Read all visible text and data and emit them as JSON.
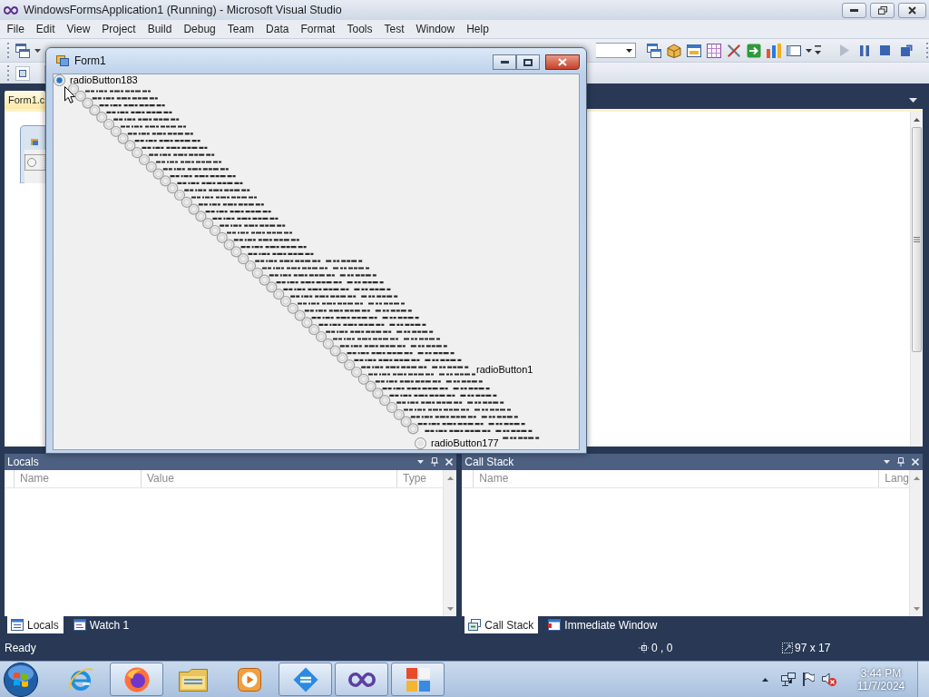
{
  "window": {
    "title": "WindowsFormsApplication1 (Running) - Microsoft Visual Studio"
  },
  "menu": [
    "File",
    "Edit",
    "View",
    "Project",
    "Build",
    "Debug",
    "Team",
    "Data",
    "Format",
    "Tools",
    "Test",
    "Window",
    "Help"
  ],
  "document_tabs": [
    {
      "label": "Form1.c",
      "selected": true
    }
  ],
  "form_window": {
    "title": "Form1",
    "radio_buttons": [
      {
        "label": "radioButton183",
        "selected": true
      },
      {
        "label": "radioButton177",
        "selected": false
      }
    ],
    "covered_radio_label": "radioButton1"
  },
  "panels": [
    {
      "title": "Locals",
      "columns": [
        "Name",
        "Value",
        "Type"
      ],
      "tabs": [
        {
          "label": "Locals",
          "selected": true
        },
        {
          "label": "Watch 1",
          "selected": false
        }
      ]
    },
    {
      "title": "Call Stack",
      "columns": [
        "Name",
        "Lang"
      ],
      "tabs": [
        {
          "label": "Call Stack",
          "selected": true
        },
        {
          "label": "Immediate Window",
          "selected": false
        }
      ]
    }
  ],
  "status_bar": {
    "text": "Ready",
    "position": "0 , 0",
    "size": "97 x 17"
  },
  "taskbar": {
    "apps": [
      {
        "running": false
      },
      {
        "running": true
      },
      {
        "running": false
      },
      {
        "running": false
      },
      {
        "running": true
      },
      {
        "running": true
      },
      {
        "running": true
      }
    ],
    "time": "3:44 PM",
    "date": "11/7/2024"
  }
}
